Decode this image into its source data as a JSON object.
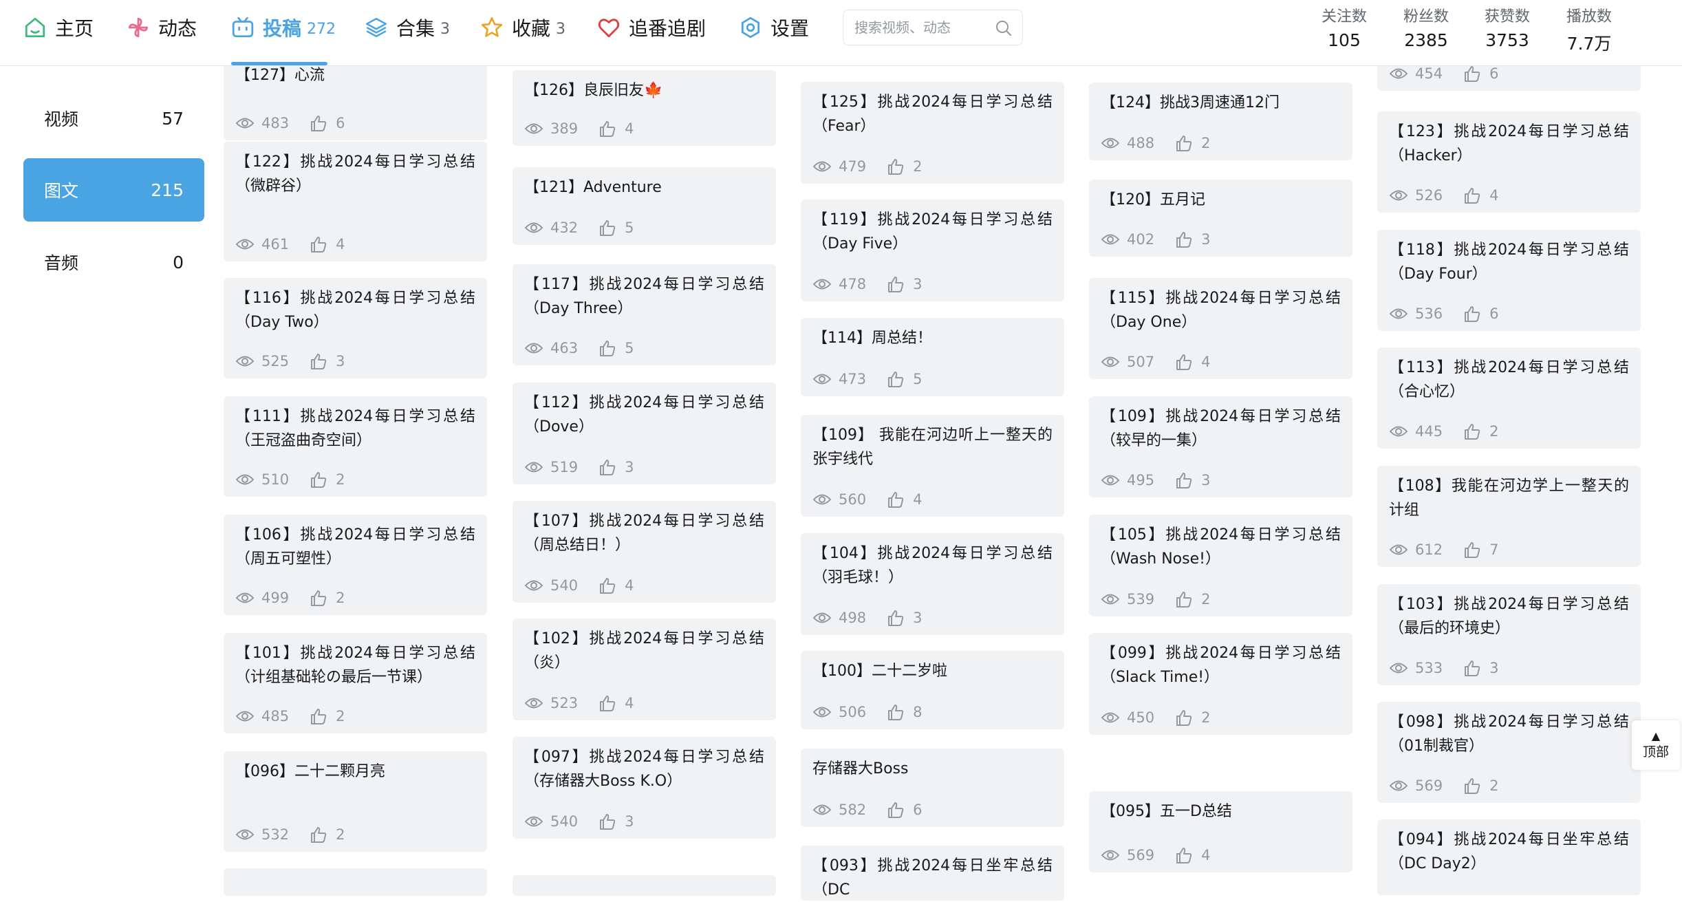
{
  "nav": [
    {
      "label": "主页",
      "count": "",
      "icon": "home-icon"
    },
    {
      "label": "动态",
      "count": "",
      "icon": "pinwheel-icon"
    },
    {
      "label": "投稿",
      "count": "272",
      "icon": "tv-icon",
      "active": true
    },
    {
      "label": "合集",
      "count": "3",
      "icon": "layers-icon"
    },
    {
      "label": "收藏",
      "count": "3",
      "icon": "star-icon"
    },
    {
      "label": "追番追剧",
      "count": "",
      "icon": "heart-icon"
    },
    {
      "label": "设置",
      "count": "",
      "icon": "gear-icon"
    }
  ],
  "search": {
    "placeholder": "搜索视频、动态"
  },
  "stats": [
    {
      "label": "关注数",
      "value": "105"
    },
    {
      "label": "粉丝数",
      "value": "2385"
    },
    {
      "label": "获赞数",
      "value": "3753"
    },
    {
      "label": "播放数",
      "value": "7.7万"
    }
  ],
  "side_menu": [
    {
      "label": "视频",
      "count": "57"
    },
    {
      "label": "图文",
      "count": "215",
      "active": true
    },
    {
      "label": "音频",
      "count": "0"
    }
  ],
  "columns": [
    [
      {
        "title": "【127】心流",
        "views": "483",
        "likes": "6"
      },
      {
        "title": "【122】挑战2024每日学习总结（微辟谷）",
        "views": "461",
        "likes": "4"
      },
      {
        "title": "【116】挑战2024每日学习总结（Day Two）",
        "views": "525",
        "likes": "3"
      },
      {
        "title": "【111】挑战2024每日学习总结（王冠盗曲奇空间）",
        "views": "510",
        "likes": "2"
      },
      {
        "title": "【106】挑战2024每日学习总结（周五可塑性）",
        "views": "499",
        "likes": "2"
      },
      {
        "title": "【101】挑战2024每日学习总结（计组基础轮の最后一节课）",
        "views": "485",
        "likes": "2"
      },
      {
        "title": "【096】二十二颗月亮",
        "views": "532",
        "likes": "2"
      },
      {
        "title": "",
        "views": "",
        "likes": ""
      }
    ],
    [
      {
        "title": "【126】良辰旧友🍁",
        "views": "389",
        "likes": "4"
      },
      {
        "title": "【121】Adventure",
        "views": "432",
        "likes": "5"
      },
      {
        "title": "【117】挑战2024每日学习总结（Day Three）",
        "views": "463",
        "likes": "5"
      },
      {
        "title": "【112】挑战2024每日学习总结（Dove）",
        "views": "519",
        "likes": "3"
      },
      {
        "title": "【107】挑战2024每日学习总结（周总结日！）",
        "views": "540",
        "likes": "4"
      },
      {
        "title": "【102】挑战2024每日学习总结（炎）",
        "views": "523",
        "likes": "4"
      },
      {
        "title": "【097】挑战2024每日学习总结（存储器大Boss K.O）",
        "views": "540",
        "likes": "3"
      },
      {
        "title": "",
        "views": "",
        "likes": ""
      }
    ],
    [
      {
        "title": "【125】挑战2024每日学习总结（Fear）",
        "views": "479",
        "likes": "2"
      },
      {
        "title": "【119】挑战2024每日学习总结（Day Five）",
        "views": "478",
        "likes": "3"
      },
      {
        "title": "【114】周总结！",
        "views": "473",
        "likes": "5"
      },
      {
        "title": "【109】 我能在河边听上一整天的张宇线代",
        "views": "560",
        "likes": "4"
      },
      {
        "title": "【104】挑战2024每日学习总结（羽毛球！）",
        "views": "498",
        "likes": "3"
      },
      {
        "title": "【100】二十二岁啦",
        "views": "506",
        "likes": "8"
      },
      {
        "title": "存储器大Boss",
        "views": "582",
        "likes": "6"
      },
      {
        "title": "【093】挑战2024每日坐牢总结（DC",
        "views": "",
        "likes": ""
      }
    ],
    [
      {
        "title": "【124】挑战3周速通12门",
        "views": "488",
        "likes": "2"
      },
      {
        "title": "【120】五月记",
        "views": "402",
        "likes": "3"
      },
      {
        "title": "【115】挑战2024每日学习总结（Day One）",
        "views": "507",
        "likes": "4"
      },
      {
        "title": "【109】挑战2024每日学习总结（较早的一集）",
        "views": "495",
        "likes": "3"
      },
      {
        "title": "【105】挑战2024每日学习总结（Wash Nose!）",
        "views": "539",
        "likes": "2"
      },
      {
        "title": "【099】挑战2024每日学习总结（Slack Time!）",
        "views": "450",
        "likes": "2"
      },
      {
        "title": "【095】五一D总结",
        "views": "569",
        "likes": "4"
      }
    ],
    [
      {
        "title": "",
        "views": "454",
        "likes": "6"
      },
      {
        "title": "【123】挑战2024每日学习总结（Hacker）",
        "views": "526",
        "likes": "4"
      },
      {
        "title": "【118】挑战2024每日学习总结（Day Four）",
        "views": "536",
        "likes": "6"
      },
      {
        "title": "【113】挑战2024每日学习总结（合心忆）",
        "views": "445",
        "likes": "2"
      },
      {
        "title": "【108】我能在河边学上一整天的计组",
        "views": "612",
        "likes": "7"
      },
      {
        "title": "【103】挑战2024每日学习总结（最后的环境史）",
        "views": "533",
        "likes": "3"
      },
      {
        "title": "【098】挑战2024每日学习总结（01制裁官）",
        "views": "569",
        "likes": "2"
      },
      {
        "title": "【094】挑战2024每日坐牢总结（DC Day2）",
        "views": "",
        "likes": ""
      }
    ]
  ],
  "back_top": {
    "label": "顶部"
  },
  "colors": {
    "accent": "#4aa3e2",
    "card_bg": "#f1f2f3",
    "meta": "#9499a0"
  }
}
